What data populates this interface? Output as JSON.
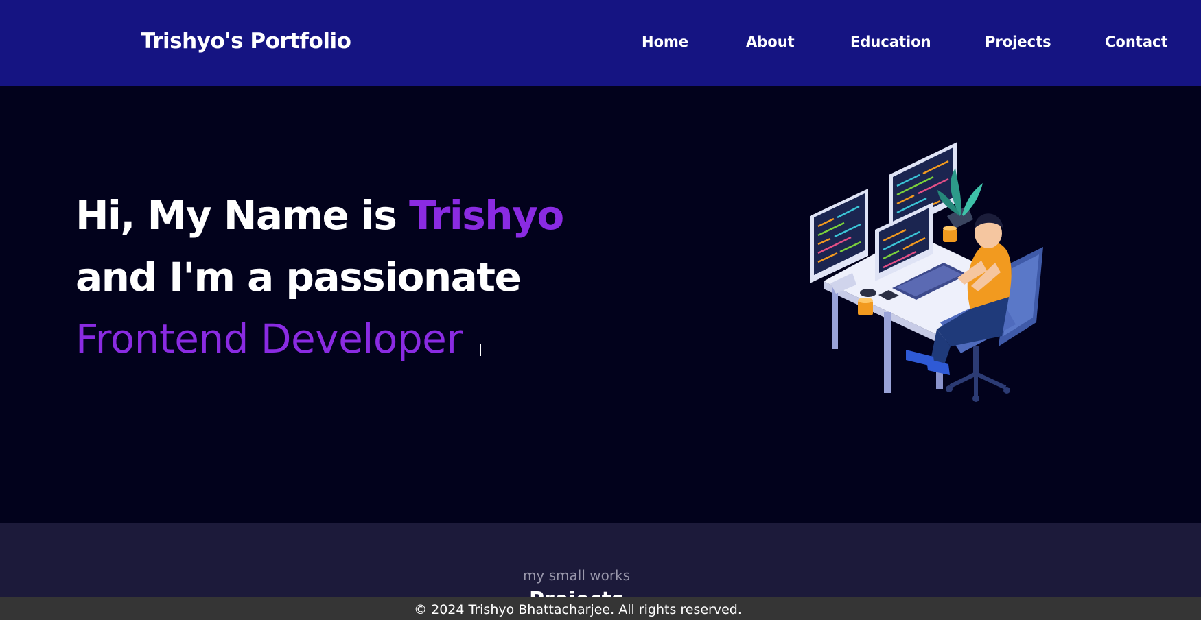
{
  "header": {
    "brand": "Trishyo's Portfolio",
    "nav": [
      "Home",
      "About",
      "Education",
      "Projects",
      "Contact"
    ]
  },
  "hero": {
    "line1_prefix": "Hi, My Name is ",
    "line1_name": "Trishyo",
    "line2": "and I'm a passionate",
    "role": "Frontend Developer",
    "illustration": "developer-at-desk-illustration"
  },
  "projects": {
    "subtitle": "my small works",
    "title": "Projects"
  },
  "footer": {
    "text": "© 2024 Trishyo Bhattacharjee. All rights reserved."
  },
  "colors": {
    "navbar": "#151482",
    "hero_bg": "#02021c",
    "accent": "#8a2be2",
    "projects_bg": "#1c1a3a",
    "footer_bg": "#353535"
  }
}
